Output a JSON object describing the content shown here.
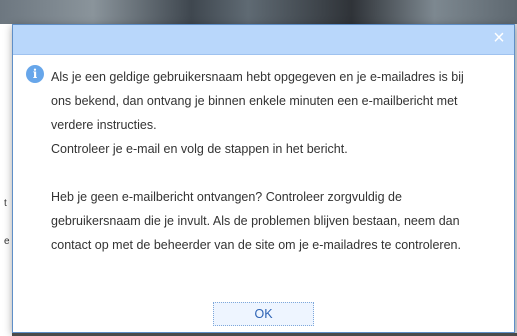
{
  "background": {
    "left_marks": [
      "t",
      "e"
    ]
  },
  "dialog": {
    "close_label": "×",
    "info_icon": "info-icon",
    "message": {
      "line_1": "Als je een geldige gebruikersnaam hebt opgegeven en je e-mailadres is bij",
      "line_2": "ons bekend, dan ontvang je binnen enkele minuten een e-mailbericht met",
      "line_3": "verdere instructies.",
      "line_4": "Controleer je e-mail en volg de stappen in het bericht.",
      "line_5": "Heb je geen e-mailbericht ontvangen? Controleer zorgvuldig de",
      "line_6": "gebruikersnaam die je invult. Als de problemen blijven bestaan, neem dan",
      "line_7": "contact op met de beheerder van de site om je e-mailadres te controleren."
    },
    "ok_label": "OK"
  },
  "colors": {
    "titlebar": "#b9d7fb",
    "dialog_border": "#5f8fc8",
    "info_icon": "#67a6ea",
    "ok_text": "#2d63b5"
  }
}
